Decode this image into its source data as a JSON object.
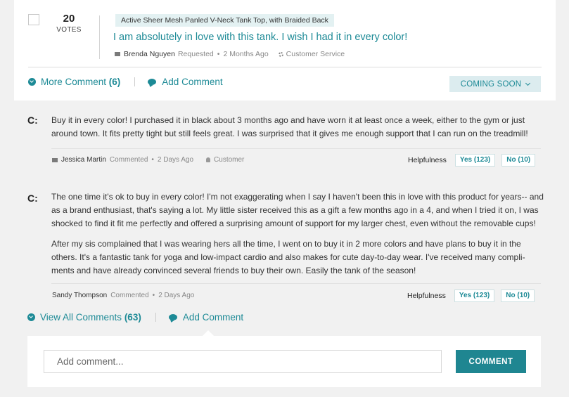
{
  "question": {
    "votes": "20",
    "votes_label": "VOTES",
    "product_tag": "Active Sheer Mesh Panled V-Neck Tank Top, with Braided Back",
    "title": "I am absolutely in love with this tank. I wish I had it in every color!",
    "author": "Brenda Nguyen",
    "action": "Requested",
    "time": "2 Months Ago",
    "role": "Customer Service"
  },
  "question_actions": {
    "more_comment_label": "More Comment",
    "more_comment_count": "(6)",
    "add_comment_label": "Add Comment",
    "coming_soon_label": "COMING SOON"
  },
  "comments": [
    {
      "label": "C:",
      "paragraphs": [
        "Buy it in every color! I purchased it in black about 3 months ago and have worn it at least once a week, either to the gym or just around town. It fits pretty tight but still feels great. I was surprised that it gives me enough support that I can run on the treadmill!"
      ],
      "author": "Jessica Martin",
      "action": "Commented",
      "time": "2 Days Ago",
      "role": "Customer",
      "helpfulness_label": "Helpfulness",
      "yes_label": "Yes (123)",
      "no_label": "No (10)"
    },
    {
      "label": "C:",
      "paragraphs": [
        "The one time it's ok to buy in every color! I'm not exaggerating when I say I haven't been this in love with this product for years-- and as a brand enthusiast, that's saying a lot. My little sister received this as a gift a few months ago in a 4, and when I tried it on, I was shocked to find it fit me perfectly and offered a surprising amount of support for my larger chest, even without the removable cups!",
        "After my sis complained that I was wearing hers all the time, I went on to buy it in 2 more colors and have plans to buy it in the others. It's a fantastic tank for yoga and low-impact cardio and also makes for cute day-to-day wear. I've received many compli-ments and have already convinced several friends to buy their own. Easily the tank of the season!"
      ],
      "author": "Sandy Thompson",
      "action": "Commented",
      "time": "2 Days Ago",
      "helpfulness_label": "Helpfulness",
      "yes_label": "Yes (123)",
      "no_label": "No (10)"
    }
  ],
  "footer": {
    "view_all_label": "View All Comments",
    "view_all_count": "(63)",
    "add_comment_label": "Add Comment"
  },
  "comment_form": {
    "placeholder": "Add comment...",
    "submit_label": "COMMENT"
  }
}
